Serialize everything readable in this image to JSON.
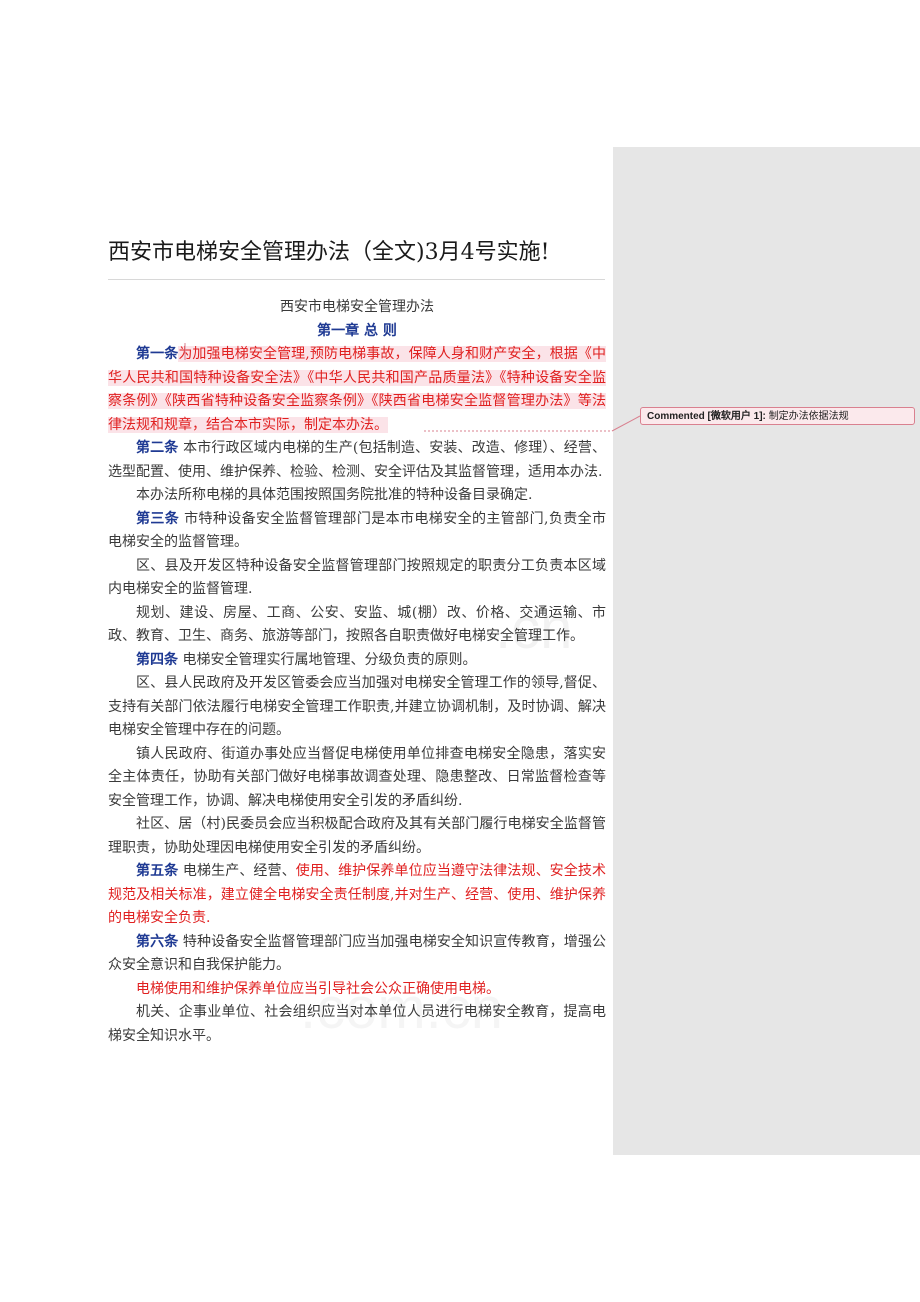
{
  "document": {
    "title": "西安市电梯安全管理办法（全文)3月4号实施!",
    "subtitle": "西安市电梯安全管理办法",
    "chapter": "第一章 总 则",
    "paragraphs": [
      {
        "label": "第一条",
        "text": "为加强电梯安全管理,预防电梯事故，保障人身和财产安全，根据《中华人民共和国特种设备安全法》《中华人民共和国产品质量法》《特种设备安全监察条例》《陕西省特种设备安全监察条例》《陕西省电梯安全监督管理办法》等法律法规和规章，结合本市实际，制定本办法。",
        "red": true
      },
      {
        "label": "第二条",
        "text": "本市行政区域内电梯的生产(包括制造、安装、改造、修理）、经营、选型配置、使用、维护保养、检验、检测、安全评估及其监督管理，适用本办法.",
        "red": false
      },
      {
        "label": "",
        "text": "本办法所称电梯的具体范围按照国务院批准的特种设备目录确定.",
        "red": false
      },
      {
        "label": "第三条",
        "text": "市特种设备安全监督管理部门是本市电梯安全的主管部门,负责全市电梯安全的监督管理。",
        "red": false
      },
      {
        "label": "",
        "text": "区、县及开发区特种设备安全监督管理部门按照规定的职责分工负责本区域内电梯安全的监督管理.",
        "red": false
      },
      {
        "label": "",
        "text": "规划、建设、房屋、工商、公安、安监、城(棚）改、价格、交通运输、市政、教育、卫生、商务、旅游等部门，按照各自职责做好电梯安全管理工作。",
        "red": false
      },
      {
        "label": "第四条",
        "text": "电梯安全管理实行属地管理、分级负责的原则。",
        "red": false
      },
      {
        "label": "",
        "text": "区、县人民政府及开发区管委会应当加强对电梯安全管理工作的领导,督促、支持有关部门依法履行电梯安全管理工作职责,并建立协调机制，及时协调、解决电梯安全管理中存在的问题。",
        "red": false
      },
      {
        "label": "",
        "text": "镇人民政府、街道办事处应当督促电梯使用单位排查电梯安全隐患，落实安全主体责任，协助有关部门做好电梯事故调查处理、隐患整改、日常监督检查等安全管理工作，协调、解决电梯使用安全引发的矛盾纠纷.",
        "red": false
      },
      {
        "label": "",
        "text": "社区、居（村)民委员会应当积极配合政府及其有关部门履行电梯安全监督管理职责，协助处理因电梯使用安全引发的矛盾纠纷。",
        "red": false
      },
      {
        "label": "第五条",
        "text": "电梯生产、经营、使用、维护保养单位应当遵守法律法规、安全技术规范及相关标准，建立健全电梯安全责任制度,并对生产、经营、使用、维护保养的电梯安全负责.",
        "red": "partial"
      },
      {
        "label": "第六条",
        "text": "特种设备安全监督管理部门应当加强电梯安全知识宣传教育，增强公众安全意识和自我保护能力。",
        "red": false
      },
      {
        "label": "",
        "text": "电梯使用和维护保养单位应当引导社会公众正确使用电梯。",
        "red": true
      },
      {
        "label": "",
        "text": "机关、企事业单位、社会组织应当对本单位人员进行电梯安全教育，提高电梯安全知识水平。",
        "red": false
      }
    ],
    "art5_black": "电梯生产、经营、",
    "art5_red": "使用、维护保养单位应当遵守法律法规、安全技术规范及相关标准，建立健全电梯安全责任制度,并对生产、经营、使用、维护保养的电梯安全负责."
  },
  "comment": {
    "author": "Commented [微软用户 1]:",
    "text": "制定办法依据法规"
  },
  "colors": {
    "label": "#1f3a93",
    "red": "#e02020",
    "text": "#3a3a3a",
    "sidebar": "#e6e6e6",
    "comment_border": "#d9808f"
  }
}
